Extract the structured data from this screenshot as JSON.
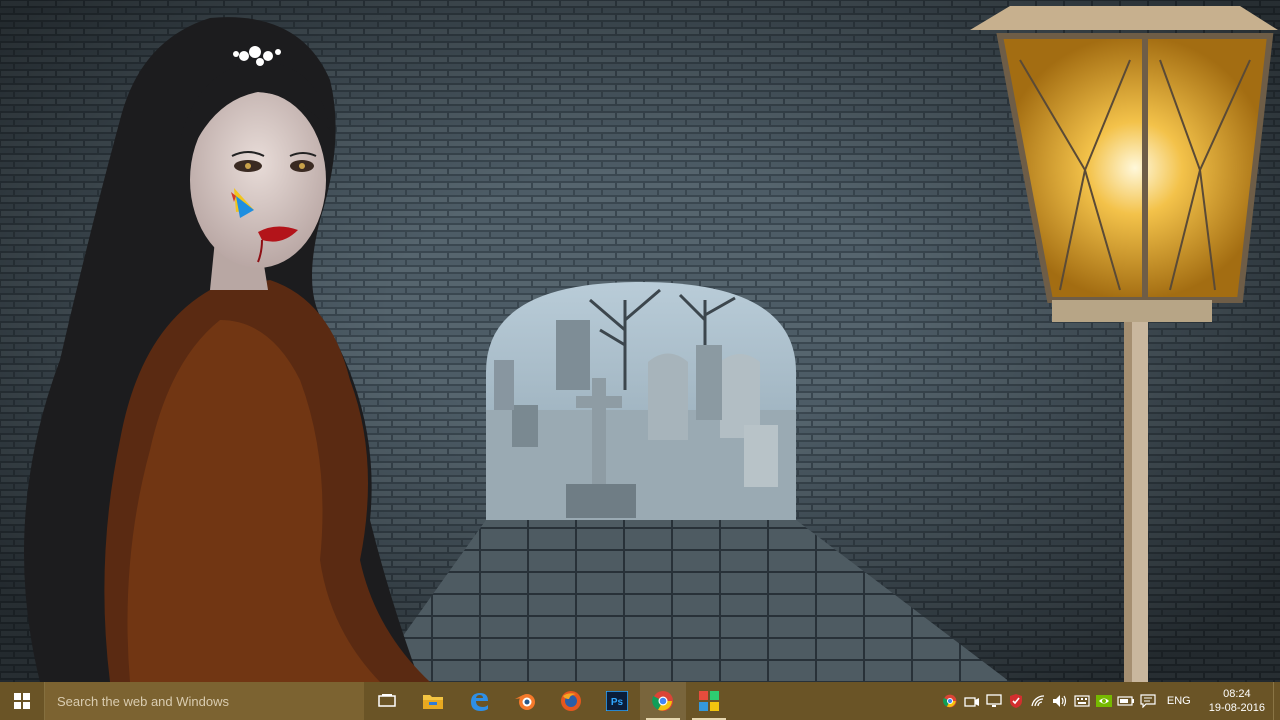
{
  "taskbar": {
    "search_placeholder": "Search the web and Windows",
    "pinned": [
      {
        "name": "task-view",
        "icon": "task-view-icon"
      },
      {
        "name": "file-explorer",
        "icon": "folder-icon"
      },
      {
        "name": "edge",
        "icon": "edge-icon"
      },
      {
        "name": "blender",
        "icon": "blender-icon"
      },
      {
        "name": "firefox",
        "icon": "firefox-icon"
      },
      {
        "name": "photoshop",
        "icon": "photoshop-icon",
        "label": "Ps"
      },
      {
        "name": "chrome",
        "icon": "chrome-icon",
        "active": true
      },
      {
        "name": "app-grid",
        "icon": "colored-tiles-icon"
      }
    ],
    "tray": {
      "language": "ENG",
      "time": "08:24",
      "date": "19-08-2016"
    }
  },
  "colors": {
    "taskbar": "#6a5426",
    "search_box": "#7c6331",
    "lamp_glow": "#f3c24a"
  }
}
